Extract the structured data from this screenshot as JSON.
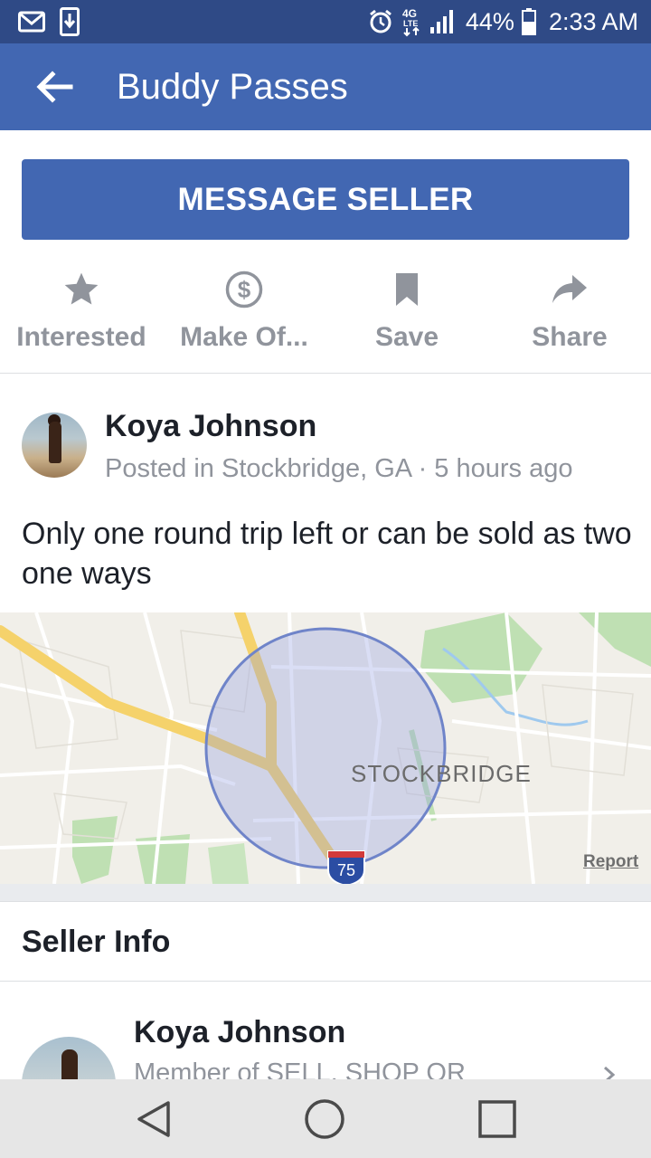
{
  "status_bar": {
    "network": "4G LTE",
    "battery": "44%",
    "time": "2:33 AM",
    "icons": [
      "gmail-icon",
      "download-icon",
      "alarm-icon",
      "network-4g-icon",
      "signal-icon",
      "battery-icon"
    ]
  },
  "app_bar": {
    "title": "Buddy Passes",
    "back_icon": "arrow-left-icon"
  },
  "message_button": {
    "label": "MESSAGE SELLER"
  },
  "actions": [
    {
      "label": "Interested",
      "icon": "star-icon"
    },
    {
      "label": "Make Of...",
      "icon": "dollar-circle-icon"
    },
    {
      "label": "Save",
      "icon": "bookmark-icon"
    },
    {
      "label": "Share",
      "icon": "share-arrow-icon"
    }
  ],
  "post": {
    "author": "Koya Johnson",
    "meta": "Posted in Stockbridge, GA · 5 hours ago",
    "body": "Only one round trip left or can be sold as two one ways"
  },
  "map": {
    "city_label": "STOCKBRIDGE",
    "highway_shield": "75",
    "report_link": "Report"
  },
  "seller_info": {
    "heading": "Seller Info",
    "name": "Koya Johnson",
    "subtitle": "Member of SELL, SHOP OR"
  },
  "nav_bar": {
    "icons": [
      "back-triangle-icon",
      "home-circle-icon",
      "recents-square-icon"
    ]
  },
  "colors": {
    "facebook_blue": "#4267b2",
    "status_bar": "#2f4a86",
    "muted_text": "#90949c",
    "highway": "#f5d26b",
    "radius_fill": "#8e9be0"
  }
}
